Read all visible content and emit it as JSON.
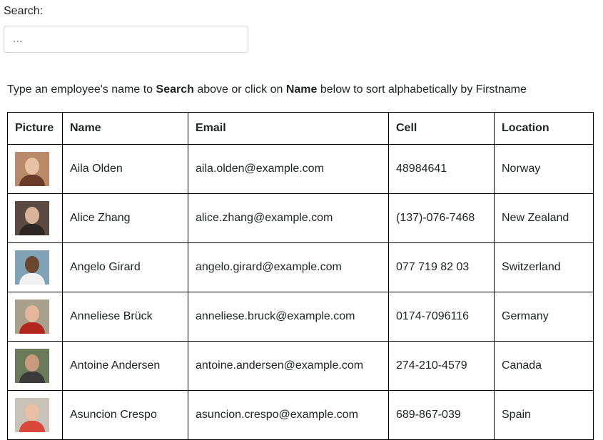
{
  "search": {
    "label": "Search:",
    "placeholder": "...",
    "value": ""
  },
  "instructions": {
    "part1": "Type an employee's name to ",
    "bold1": "Search",
    "part2": " above or click on ",
    "bold2": "Name",
    "part3": " below to sort alphabetically by Firstname"
  },
  "table": {
    "headers": [
      "Picture",
      "Name",
      "Email",
      "Cell",
      "Location"
    ],
    "rows": [
      {
        "name": "Aila Olden",
        "email": "aila.olden@example.com",
        "cell": "48984641",
        "location": "Norway",
        "photo": {
          "bg": "#b98a6a",
          "skin": "#e8c2a2",
          "cloth": "#6b3b2a"
        }
      },
      {
        "name": "Alice Zhang",
        "email": "alice.zhang@example.com",
        "cell": "(137)-076-7468",
        "location": "New Zealand",
        "photo": {
          "bg": "#5a4a42",
          "skin": "#d9b49a",
          "cloth": "#2e2622"
        }
      },
      {
        "name": "Angelo Girard",
        "email": "angelo.girard@example.com",
        "cell": "077 719 82 03",
        "location": "Switzerland",
        "photo": {
          "bg": "#7fa2b6",
          "skin": "#6b4630",
          "cloth": "#f1f1f1"
        }
      },
      {
        "name": "Anneliese Brück",
        "email": "anneliese.bruck@example.com",
        "cell": "0174-7096116",
        "location": "Germany",
        "photo": {
          "bg": "#a8a08a",
          "skin": "#e3b89a",
          "cloth": "#b3261e"
        }
      },
      {
        "name": "Antoine Andersen",
        "email": "antoine.andersen@example.com",
        "cell": "274-210-4579",
        "location": "Canada",
        "photo": {
          "bg": "#6b7a5a",
          "skin": "#c99a7c",
          "cloth": "#3a3a3a"
        }
      },
      {
        "name": "Asuncion Crespo",
        "email": "asuncion.crespo@example.com",
        "cell": "689-867-039",
        "location": "Spain",
        "photo": {
          "bg": "#c9c2b8",
          "skin": "#e9c0a4",
          "cloth": "#d9473a"
        }
      }
    ]
  }
}
